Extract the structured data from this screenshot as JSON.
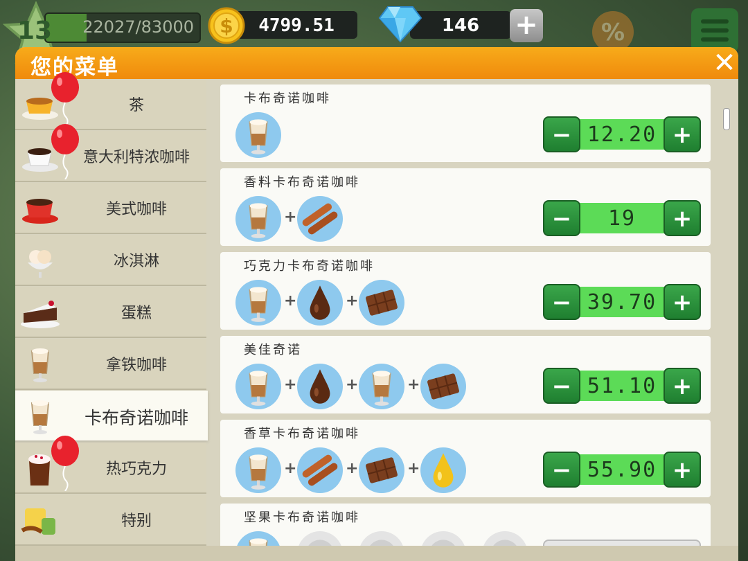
{
  "hud": {
    "level": "13",
    "xp_text": "22027/83000",
    "xp_fraction": 0.265,
    "coins": "4799.51",
    "gems": "146",
    "add_gems_label": "+",
    "percent_label": "%"
  },
  "panel": {
    "title": "您的菜单",
    "close_label": "✕"
  },
  "categories": [
    {
      "label": "茶",
      "icon": "tea-cup-icon",
      "balloon": true
    },
    {
      "label": "意大利特浓咖啡",
      "icon": "espresso-cup-icon",
      "balloon": true
    },
    {
      "label": "美式咖啡",
      "icon": "americano-cup-icon",
      "balloon": false
    },
    {
      "label": "冰淇淋",
      "icon": "ice-cream-icon",
      "balloon": false
    },
    {
      "label": "蛋糕",
      "icon": "cake-slice-icon",
      "balloon": false
    },
    {
      "label": "拿铁咖啡",
      "icon": "latte-glass-icon",
      "balloon": false
    },
    {
      "label": "卡布奇诺咖啡",
      "icon": "cappuccino-glass-icon",
      "balloon": false,
      "active": true
    },
    {
      "label": "热巧克力",
      "icon": "hot-chocolate-icon",
      "balloon": true
    },
    {
      "label": "特别",
      "icon": "special-drink-icon",
      "balloon": false
    }
  ],
  "recipes": [
    {
      "name": "卡布奇诺咖啡",
      "ingredients": [
        "cappuccino"
      ],
      "price": "12.20"
    },
    {
      "name": "香料卡布奇诺咖啡",
      "ingredients": [
        "cappuccino",
        "cinnamon"
      ],
      "price": "19"
    },
    {
      "name": "巧克力卡布奇诺咖啡",
      "ingredients": [
        "cappuccino",
        "chocolate-syrup",
        "chocolate-bar"
      ],
      "price": "39.70"
    },
    {
      "name": "美佳奇诺",
      "ingredients": [
        "cappuccino",
        "chocolate-syrup",
        "cappuccino",
        "chocolate-bar"
      ],
      "price": "51.10"
    },
    {
      "name": "香草卡布奇诺咖啡",
      "ingredients": [
        "cappuccino",
        "cinnamon",
        "chocolate-bar",
        "vanilla-drop"
      ],
      "price": "55.90"
    },
    {
      "name": "坚果卡布奇诺咖啡",
      "ingredients": [
        "cappuccino",
        "locked",
        "locked",
        "locked",
        "locked"
      ],
      "price": "",
      "locked": true
    }
  ],
  "stepper": {
    "minus": "−",
    "plus": "+"
  },
  "plus_sign": "+",
  "colors": {
    "header": "#f59e12",
    "stepper_green": "#5cdb57",
    "ingredient_bg": "#8ec9ee"
  }
}
